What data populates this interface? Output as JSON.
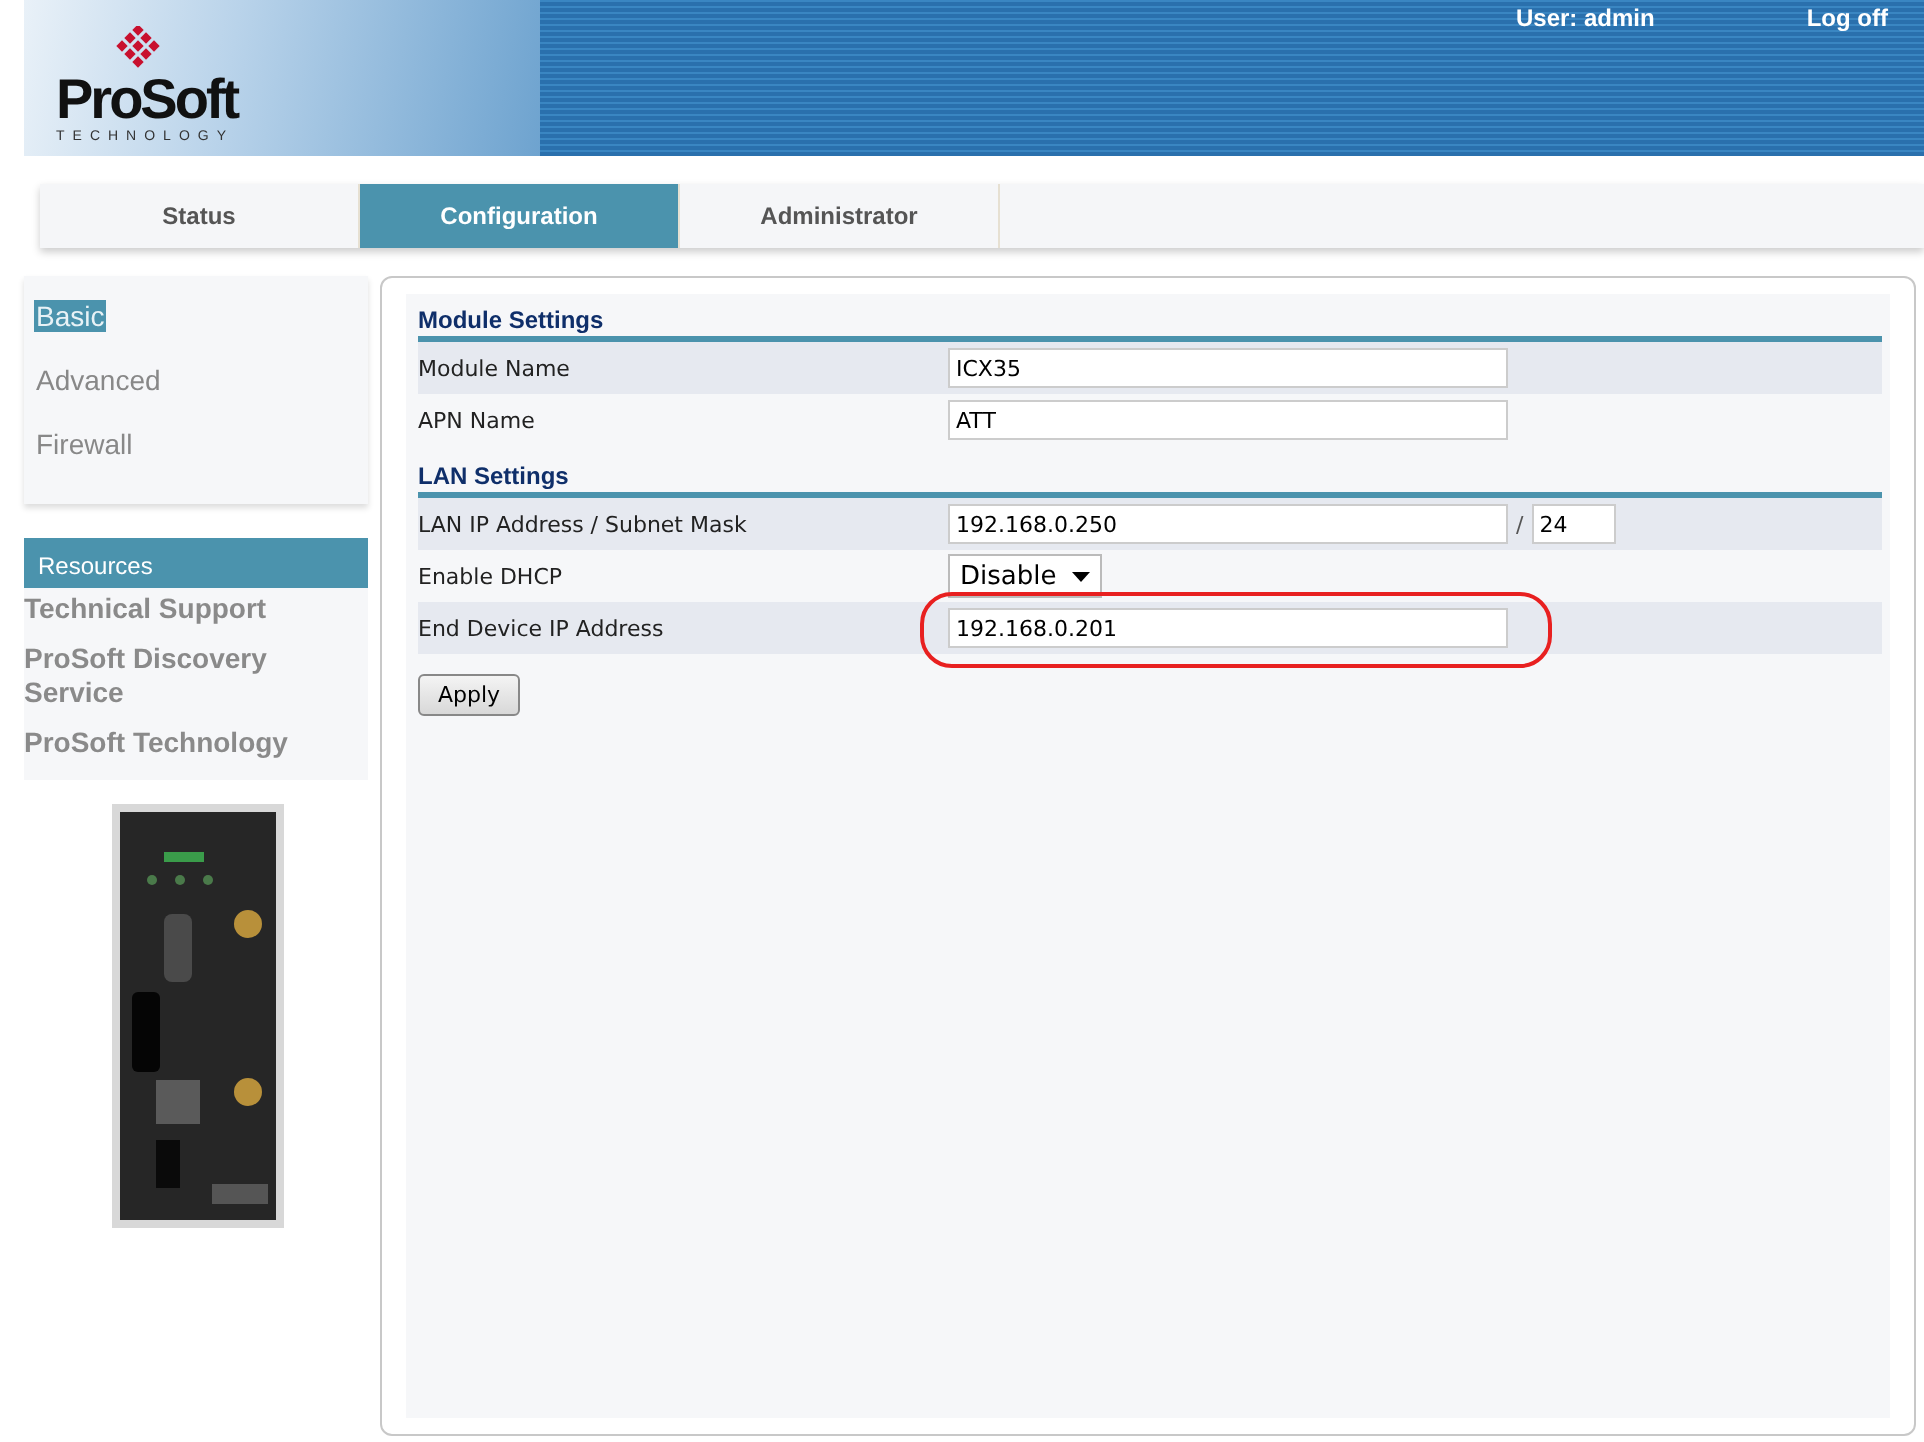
{
  "header": {
    "logo": {
      "name": "ProSoft",
      "tagline": "TECHNOLOGY"
    },
    "user": "User: admin",
    "logoff": "Log off"
  },
  "tabs": [
    {
      "label": "Status",
      "selected": false
    },
    {
      "label": "Configuration",
      "selected": true
    },
    {
      "label": "Administrator",
      "selected": false
    }
  ],
  "sidebar": {
    "items": [
      {
        "label": "Basic",
        "selected": true
      },
      {
        "label": "Advanced",
        "selected": false
      },
      {
        "label": "Firewall",
        "selected": false
      }
    ],
    "resources_title": "Resources",
    "links": [
      "Technical Support",
      "ProSoft Discovery Service",
      "ProSoft Technology"
    ]
  },
  "sections": [
    {
      "title": "Module Settings",
      "rows": [
        {
          "label": "Module Name",
          "kind": "text",
          "value": "ICX35",
          "highlighted": false
        },
        {
          "label": "APN Name",
          "kind": "text",
          "value": "ATT",
          "highlighted": false
        }
      ]
    },
    {
      "title": "LAN Settings",
      "rows": [
        {
          "label": "LAN IP Address / Subnet Mask",
          "kind": "ip_mask",
          "value": "192.168.0.250",
          "separator": "/",
          "mask": "24",
          "highlighted": false
        },
        {
          "label": "Enable DHCP",
          "kind": "select",
          "value": "Disable",
          "highlighted": false
        },
        {
          "label": "End Device IP Address",
          "kind": "text",
          "value": "192.168.0.201",
          "highlighted": true
        }
      ]
    }
  ],
  "apply_button": "Apply"
}
